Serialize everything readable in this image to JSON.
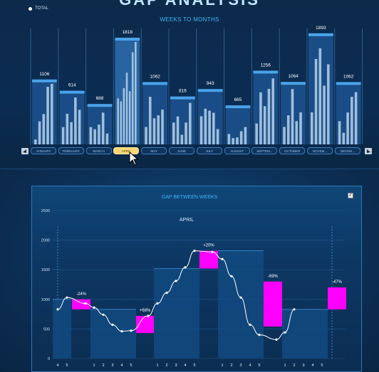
{
  "header": {
    "title_partial": "GAP ANALYSIS",
    "legend_label": "TOTAL",
    "weeks_title": "WEEKS TO MONTHS"
  },
  "months": [
    {
      "label": "JANUARY",
      "total": 1106,
      "selected": false
    },
    {
      "label": "FEBRUARY",
      "total": 914,
      "selected": false
    },
    {
      "label": "MARCH",
      "total": 688,
      "selected": false
    },
    {
      "label": "APRIL",
      "total": 1818,
      "selected": true
    },
    {
      "label": "MAY",
      "total": 1062,
      "selected": false
    },
    {
      "label": "JUNE",
      "total": 816,
      "selected": false
    },
    {
      "label": "JULY",
      "total": 943,
      "selected": false
    },
    {
      "label": "AUGUST",
      "total": 665,
      "selected": false
    },
    {
      "label": "SEPTEM...",
      "total": 1256,
      "selected": false
    },
    {
      "label": "OCTOBER",
      "total": 1064,
      "selected": false
    },
    {
      "label": "NOVEM...",
      "total": 1893,
      "selected": false
    },
    {
      "label": "DECEM...",
      "total": 1062,
      "selected": false
    }
  ],
  "selected_button_label": "APRIL",
  "gap_panel": {
    "title": "GAP BETWEEN WEEKS",
    "month": "APRIL",
    "checkbox_checked": true
  },
  "colors": {
    "accent": "#3fb4ff",
    "gap_box": "#ff00ff",
    "selected_button": "#f7d774"
  },
  "chart_data": [
    {
      "type": "bar",
      "title": "WEEKS TO MONTHS",
      "categories": [
        "JANUARY",
        "FEBRUARY",
        "MARCH",
        "APRIL",
        "MAY",
        "JUNE",
        "JULY",
        "AUGUST",
        "SEPTEM...",
        "OCTOBER",
        "NOVEM...",
        "DECEM..."
      ],
      "series": [
        {
          "name": "TOTAL",
          "values": [
            1106,
            914,
            688,
            1818,
            1062,
            816,
            943,
            665,
            1256,
            1064,
            1893,
            1062
          ]
        }
      ],
      "weekly_bars_relative": [
        [
          0.08,
          0.38,
          0.5,
          0.95,
          1.0
        ],
        [
          0.35,
          0.62,
          0.45,
          0.95,
          0.7
        ],
        [
          0.48,
          0.42,
          0.55,
          0.88,
          0.3
        ],
        [
          0.45,
          0.42,
          0.55,
          0.7,
          0.52,
          0.9,
          1.0
        ],
        [
          0.3,
          0.82,
          0.45,
          0.5,
          0.6
        ],
        [
          0.5,
          0.64,
          0.22,
          0.5,
          0.95
        ],
        [
          0.55,
          0.7,
          0.66,
          0.62,
          0.3
        ],
        [
          0.3,
          0.18,
          0.2,
          0.38,
          0.5
        ],
        [
          0.3,
          0.75,
          0.55,
          0.8,
          0.95
        ],
        [
          0.3,
          0.5,
          0.95,
          0.4,
          0.55
        ],
        [
          0.3,
          0.8,
          0.9,
          0.55,
          0.75
        ],
        [
          0.4,
          0.2,
          0.55,
          0.82,
          0.9
        ]
      ],
      "legend": "top-left",
      "grid": false
    },
    {
      "type": "bar",
      "title": "GAP BETWEEN WEEKS",
      "subtitle": "APRIL",
      "ylim": [
        0,
        2500
      ],
      "yticks": [
        0,
        500,
        1000,
        1500,
        2000,
        2500
      ],
      "x_labels": [
        "4",
        "5",
        "1",
        "2",
        "3",
        "4",
        "5",
        "1",
        "2",
        "3",
        "4",
        "5",
        "1",
        "2",
        "3",
        "4",
        "5",
        "1",
        "2",
        "3",
        "4",
        "5"
      ],
      "step_levels": [
        1000,
        830,
        1520,
        1820,
        830
      ],
      "gap_boxes": [
        {
          "label": "-24%",
          "from": 1000,
          "to": 830
        },
        {
          "label": "+68%",
          "from": 430,
          "to": 720
        },
        {
          "label": "+20%",
          "from": 1520,
          "to": 1820
        },
        {
          "label": "-69%",
          "from": 1300,
          "to": 540
        },
        {
          "label": "-47%",
          "from": 1200,
          "to": 830
        }
      ],
      "line_values": [
        830,
        1030,
        930,
        860,
        740,
        570,
        460,
        470,
        720,
        930,
        1110,
        1310,
        1540,
        1820,
        1800,
        1680,
        1390,
        1030,
        570,
        400,
        320,
        440,
        830
      ],
      "grid": true
    }
  ]
}
